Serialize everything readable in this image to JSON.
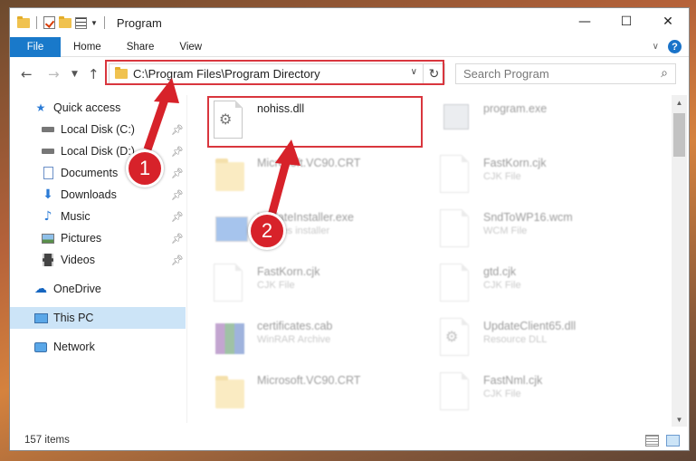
{
  "window": {
    "title": "Program",
    "controls": {
      "minimize": "—",
      "maximize": "☐",
      "close": "✕"
    }
  },
  "ribbon": {
    "tabs": [
      "File",
      "Home",
      "Share",
      "View"
    ],
    "expand_icon": "chevron-down-icon",
    "help_label": "?"
  },
  "address": {
    "path": "C:\\Program Files\\Program Directory",
    "refresh_icon": "refresh-icon"
  },
  "search": {
    "placeholder": "Search Program"
  },
  "sidebar": {
    "items": [
      {
        "label": "Quick access",
        "icon": "star-icon",
        "pinned": false
      },
      {
        "label": "Local Disk (C:)",
        "icon": "drive-icon",
        "pinned": true
      },
      {
        "label": "Local Disk (D:)",
        "icon": "drive-icon",
        "pinned": true
      },
      {
        "label": "Documents",
        "icon": "documents-icon",
        "pinned": true
      },
      {
        "label": "Downloads",
        "icon": "download-icon",
        "pinned": true
      },
      {
        "label": "Music",
        "icon": "music-icon",
        "pinned": true
      },
      {
        "label": "Pictures",
        "icon": "pictures-icon",
        "pinned": true
      },
      {
        "label": "Videos",
        "icon": "videos-icon",
        "pinned": true
      },
      {
        "label": "OneDrive",
        "icon": "cloud-icon",
        "pinned": false
      },
      {
        "label": "This PC",
        "icon": "computer-icon",
        "pinned": false,
        "selected": true
      },
      {
        "label": "Network",
        "icon": "network-icon",
        "pinned": false
      }
    ]
  },
  "files": [
    {
      "name": "nohiss.dll",
      "type": "",
      "icon": "settings-file-icon",
      "highlighted": true
    },
    {
      "name": "program.exe",
      "type": "",
      "icon": "exe-icon"
    },
    {
      "name": "Microsoft.VC90.CRT",
      "type": "",
      "icon": "folder-icon"
    },
    {
      "name": "FastKorn.cjk",
      "type": "CJK File",
      "icon": "document-icon"
    },
    {
      "name": "UpdateInstaller.exe",
      "type": "updates installer",
      "icon": "installer-icon"
    },
    {
      "name": "SndToWP16.wcm",
      "type": "WCM File",
      "icon": "document-icon"
    },
    {
      "name": "FastKorn.cjk",
      "type": "CJK File",
      "icon": "document-icon"
    },
    {
      "name": "gtd.cjk",
      "type": "CJK File",
      "icon": "document-icon"
    },
    {
      "name": "certificates.cab",
      "type": "WinRAR Archive",
      "icon": "archive-icon"
    },
    {
      "name": "UpdateClient65.dll",
      "type": "Resource DLL",
      "icon": "settings-file-icon"
    },
    {
      "name": "Microsoft.VC90.CRT",
      "type": "",
      "icon": "folder-icon"
    },
    {
      "name": "FastNml.cjk",
      "type": "CJK File",
      "icon": "document-icon"
    }
  ],
  "status": {
    "item_count": "157 items"
  },
  "annotations": {
    "step1": "1",
    "step2": "2",
    "color": "#d7222a"
  }
}
